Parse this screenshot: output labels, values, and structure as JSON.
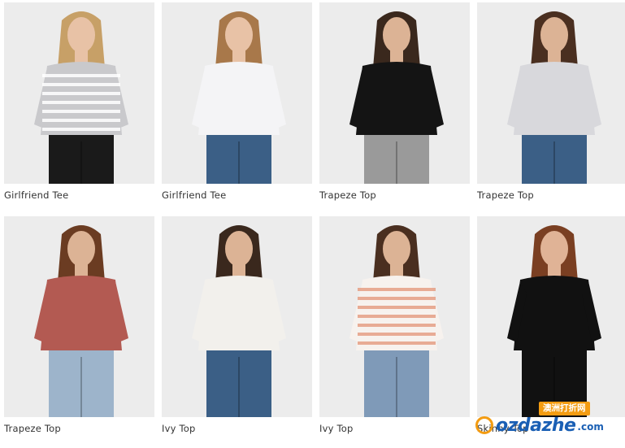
{
  "products": [
    {
      "name": "Girlfriend Tee",
      "top_color": "#c9c9cc",
      "stripe": "#ffffff",
      "bottom_color": "#1a1a1a",
      "skin": "#e8c2a6",
      "hair": "#c7a067",
      "bg": "#ececec"
    },
    {
      "name": "Girlfriend Tee",
      "top_color": "#f4f4f6",
      "stripe": "",
      "bottom_color": "#3b5f86",
      "skin": "#e8c2a6",
      "hair": "#a8784a",
      "bg": "#ececec"
    },
    {
      "name": "Trapeze Top",
      "top_color": "#141414",
      "stripe": "",
      "bottom_color": "#9a9a9a",
      "skin": "#dcb395",
      "hair": "#3a281d",
      "bg": "#ececec"
    },
    {
      "name": "Trapeze Top",
      "top_color": "#d8d8dc",
      "stripe": "",
      "bottom_color": "#3b5f86",
      "skin": "#dcb395",
      "hair": "#4a2f20",
      "bg": "#ececec"
    },
    {
      "name": "Trapeze Top",
      "top_color": "#b35a52",
      "stripe": "",
      "bottom_color": "#9db4cb",
      "skin": "#dcb395",
      "hair": "#6b3c22",
      "bg": "#ececec"
    },
    {
      "name": "Ivy Top",
      "top_color": "#f2f0ec",
      "stripe": "",
      "bottom_color": "#3b5f86",
      "skin": "#dcb395",
      "hair": "#3a281d",
      "bg": "#ececec"
    },
    {
      "name": "Ivy Top",
      "top_color": "#f7f2ee",
      "stripe": "#e59f84",
      "bottom_color": "#7f9ab8",
      "skin": "#dcb395",
      "hair": "#4a2f20",
      "bg": "#ececec"
    },
    {
      "name": "Skinny Top",
      "top_color": "#111111",
      "stripe": "",
      "bottom_color": "#111111",
      "skin": "#e0b396",
      "hair": "#7a3f22",
      "bg": "#ececec"
    }
  ],
  "watermark": {
    "badge": "澳洲打折网",
    "logo": "ozdazhe",
    "suffix": ".com"
  }
}
